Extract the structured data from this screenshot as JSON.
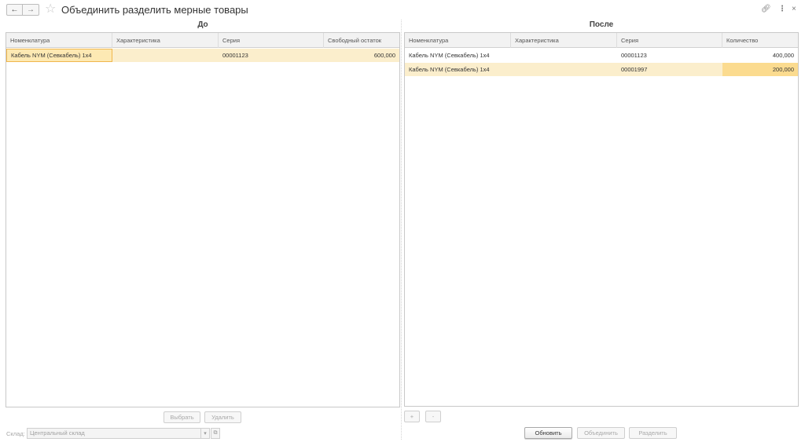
{
  "window": {
    "title": "Объединить разделить мерные товары",
    "back_icon": "arrow-left-icon",
    "forward_icon": "arrow-right-icon",
    "favorite_icon": "star-icon",
    "link_icon": "link-icon",
    "more_icon": "more-icon",
    "close_icon": "close-icon"
  },
  "before": {
    "title": "До",
    "columns": [
      "Номенклатура",
      "Характеристика",
      "Серия",
      "Свободный остаток"
    ],
    "rows": [
      {
        "item": "Кабель NYM (Севкабель) 1x4",
        "characteristic": "",
        "series": "00001123",
        "value": "600,000"
      }
    ],
    "buttons": {
      "select": "Выбрать",
      "delete": "Удалить"
    }
  },
  "after": {
    "title": "После",
    "columns": [
      "Номенклатура",
      "Характеристика",
      "Серия",
      "Количество"
    ],
    "rows": [
      {
        "item": "Кабель NYM (Севкабель) 1x4",
        "characteristic": "",
        "series": "00001123",
        "value": "400,000"
      },
      {
        "item": "Кабель NYM (Севкабель) 1x4",
        "characteristic": "",
        "series": "00001997",
        "value": "200,000"
      }
    ],
    "buttons": {
      "add": "+",
      "remove": "-",
      "refresh": "Обновить",
      "merge": "Объединить",
      "split": "Разделить"
    }
  },
  "warehouse": {
    "label": "Склад:",
    "value": "Центральный склад",
    "dropdown_icon": "dropdown-icon",
    "open_icon": "open-icon"
  },
  "colors": {
    "selected_row": "#fbeecc",
    "focused_cell": "#fbdb8f",
    "border": "#c8c8c8"
  }
}
